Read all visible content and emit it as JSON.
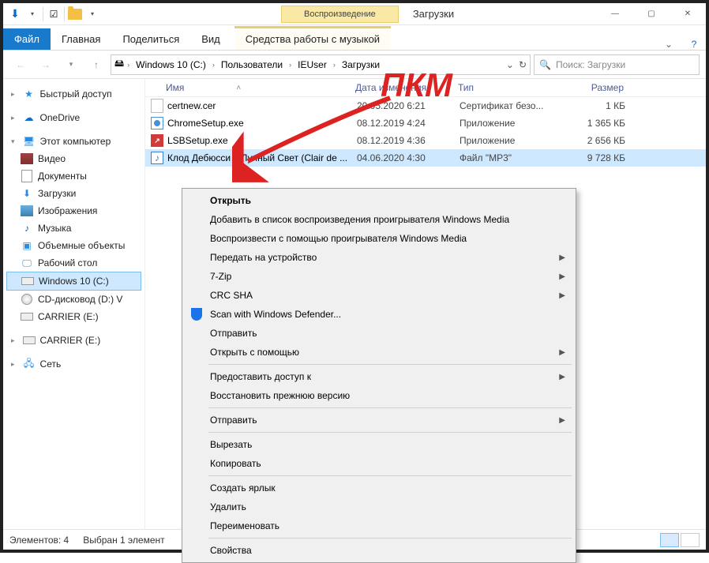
{
  "window": {
    "contextual_tab": "Воспроизведение",
    "title": "Загрузки"
  },
  "ribbon": {
    "file": "Файл",
    "tabs": [
      "Главная",
      "Поделиться",
      "Вид"
    ],
    "context_tab": "Средства работы с музыкой"
  },
  "breadcrumb": [
    "Windows 10 (C:)",
    "Пользователи",
    "IEUser",
    "Загрузки"
  ],
  "search": {
    "placeholder": "Поиск: Загрузки"
  },
  "columns": {
    "name": "Имя",
    "date": "Дата изменения",
    "type": "Тип",
    "size": "Размер"
  },
  "files": [
    {
      "name": "certnew.cer",
      "date": "20.05.2020 6:21",
      "type": "Сертификат безо...",
      "size": "1 КБ",
      "icon": "cert"
    },
    {
      "name": "ChromeSetup.exe",
      "date": "08.12.2019 4:24",
      "type": "Приложение",
      "size": "1 365 КБ",
      "icon": "exe"
    },
    {
      "name": "LSBSetup.exe",
      "date": "08.12.2019 4:36",
      "type": "Приложение",
      "size": "2 656 КБ",
      "icon": "lsb"
    },
    {
      "name": "Клод Дебюсси – Лунный Свет (Clair de ...",
      "date": "04.06.2020 4:30",
      "type": "Файл \"MP3\"",
      "size": "9 728 КБ",
      "icon": "mp3",
      "selected": true
    }
  ],
  "sidebar": {
    "quick": "Быстрый доступ",
    "onedrive": "OneDrive",
    "pc": "Этот компьютер",
    "pc_items": [
      "Видео",
      "Документы",
      "Загрузки",
      "Изображения",
      "Музыка",
      "Объемные объекты",
      "Рабочий стол",
      "Windows 10 (C:)",
      "CD-дисковод (D:) V",
      "CARRIER (E:)"
    ],
    "carrier": "CARRIER (E:)",
    "network": "Сеть"
  },
  "context_menu": {
    "open": "Открыть",
    "add_wmp": "Добавить в список воспроизведения проигрывателя Windows Media",
    "play_wmp": "Воспроизвести с помощью проигрывателя Windows Media",
    "cast": "Передать на устройство",
    "sevenzip": "7-Zip",
    "crc": "CRC SHA",
    "defender": "Scan with Windows Defender...",
    "send_to": "Отправить",
    "open_with": "Открыть с помощью",
    "give_access": "Предоставить доступ к",
    "restore": "Восстановить прежнюю версию",
    "something1": "Отправить",
    "cut": "Вырезать",
    "copy": "Копировать",
    "shortcut": "Создать ярлык",
    "delete": "Удалить",
    "rename": "Переименовать",
    "properties": "Свойства"
  },
  "status": {
    "count": "Элементов: 4",
    "selected": "Выбран 1 элемент"
  },
  "annotation": {
    "pkm": "ПКМ"
  }
}
